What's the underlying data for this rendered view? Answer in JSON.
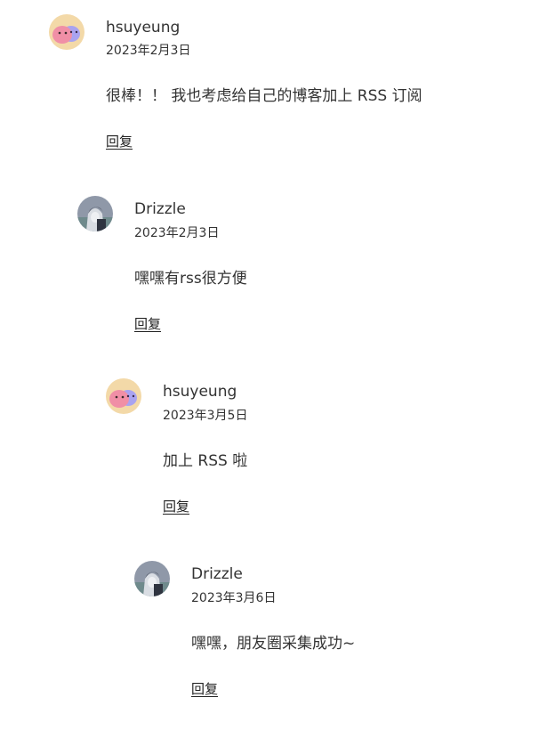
{
  "comments": [
    {
      "author": "hsuyeung",
      "date": "2023年2月3日",
      "content": "很棒！！ 我也考虑给自己的博客加上 RSS 订阅",
      "reply_label": "回复",
      "avatar_icon": "dango-avatar-icon"
    },
    {
      "author": "Drizzle",
      "date": "2023年2月3日",
      "content": "嘿嘿有rss很方便",
      "reply_label": "回复",
      "avatar_icon": "anime-avatar-icon"
    },
    {
      "author": "hsuyeung",
      "date": "2023年3月5日",
      "content": "加上 RSS 啦",
      "reply_label": "回复",
      "avatar_icon": "dango-avatar-icon"
    },
    {
      "author": "Drizzle",
      "date": "2023年3月6日",
      "content": "嘿嘿，朋友圈采集成功~",
      "reply_label": "回复",
      "avatar_icon": "anime-avatar-icon"
    }
  ],
  "colors": {
    "text": "#333333",
    "dango_bg": "#f3d9a8",
    "dango_pink": "#f08fa6",
    "dango_purple": "#a9a3f0",
    "anime_bg": "#8f98a8"
  }
}
